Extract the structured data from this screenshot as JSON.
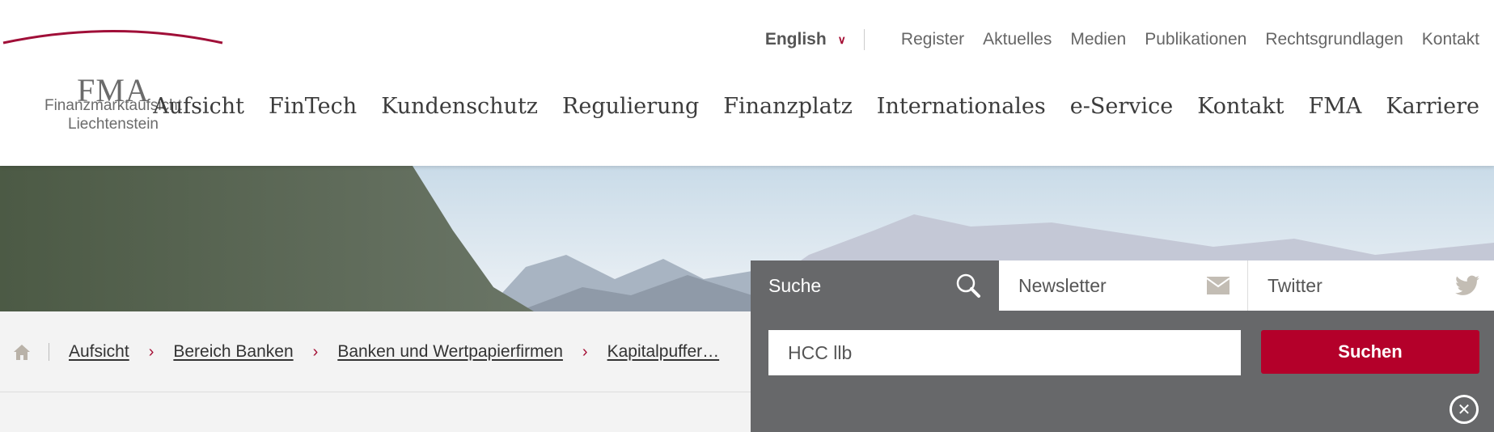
{
  "logo": {
    "text": "FMA",
    "line1": "Finanzmarktaufsicht",
    "line2": "Liechtenstein"
  },
  "top_links": {
    "language": "English",
    "items": [
      "Register",
      "Aktuelles",
      "Medien",
      "Publikationen",
      "Rechtsgrundlagen",
      "Kontakt"
    ]
  },
  "main_nav": [
    "Aufsicht",
    "FinTech",
    "Kundenschutz",
    "Regulierung",
    "Finanzplatz",
    "Internationales",
    "e-Service",
    "Kontakt",
    "FMA",
    "Karriere"
  ],
  "breadcrumb": [
    "Aufsicht",
    "Bereich Banken",
    "Banken und Wertpapierfirmen",
    "Kapitalpuffer…"
  ],
  "panel": {
    "tabs": [
      {
        "label": "Suche",
        "icon": "search-icon"
      },
      {
        "label": "Newsletter",
        "icon": "envelope-icon"
      },
      {
        "label": "Twitter",
        "icon": "twitter-bird-icon"
      }
    ],
    "search_value": "HCC llb",
    "search_button": "Suchen"
  },
  "colors": {
    "brand_red": "#b4002a",
    "panel_gray": "#67686a"
  }
}
